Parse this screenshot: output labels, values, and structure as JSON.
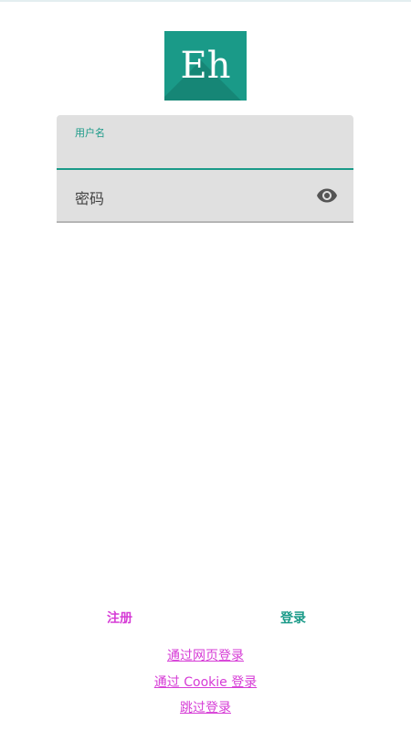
{
  "logo": {
    "text": "Eh"
  },
  "form": {
    "username_label": "用户名",
    "password_placeholder": "密码"
  },
  "buttons": {
    "register": "注册",
    "login": "登录"
  },
  "links": {
    "web_login": "通过网页登录",
    "cookie_login": "通过 Cookie 登录",
    "skip_login": "跳过登录"
  },
  "icons": {
    "password_toggle": "eye-icon"
  },
  "colors": {
    "accent": "#1a9a88",
    "link": "#d63cd6",
    "field_bg": "#e0e0e0"
  }
}
